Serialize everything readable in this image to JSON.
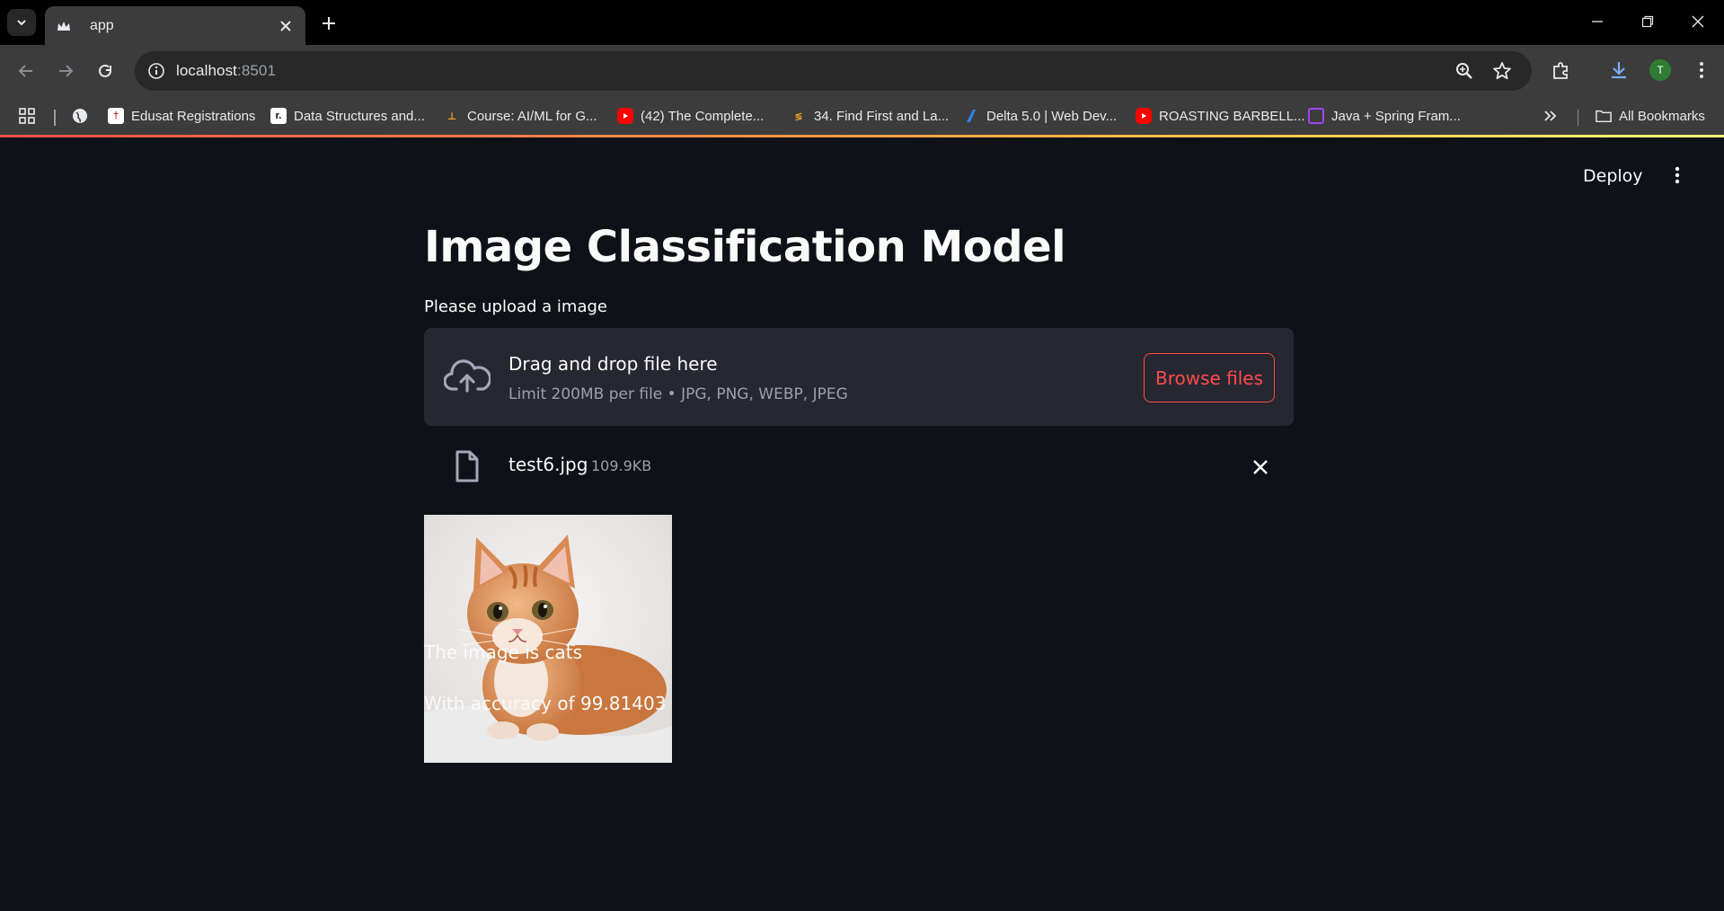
{
  "browser": {
    "tab_title": "app",
    "url_host": "localhost",
    "url_port": ":8501",
    "avatar_letter": "T",
    "bookmarks": [
      {
        "label": "Edusat Registrations"
      },
      {
        "label": "Data Structures and..."
      },
      {
        "label": "Course: AI/ML for G..."
      },
      {
        "label": "(42) The Complete..."
      },
      {
        "label": "34. Find First and La..."
      },
      {
        "label": "Delta 5.0 | Web Dev..."
      },
      {
        "label": "ROASTING BARBELL..."
      },
      {
        "label": "Java + Spring Fram..."
      }
    ],
    "all_bookmarks": "All Bookmarks"
  },
  "app": {
    "deploy_label": "Deploy",
    "title": "Image Classification Model",
    "upload_label": "Please upload a image",
    "dropzone": {
      "title": "Drag and drop file here",
      "limit": "Limit 200MB per file • JPG, PNG, WEBP, JPEG",
      "browse_label": "Browse files"
    },
    "file": {
      "name": "test6.jpg",
      "size": "109.9KB"
    },
    "result_line": "The image is cats",
    "accuracy_line": "With accuracy of 99.81403"
  },
  "colors": {
    "app_bg": "#0e1117",
    "accent": "#ff4b4b",
    "dropzone_bg": "#262730",
    "chrome_bg": "#3c3c3c"
  }
}
